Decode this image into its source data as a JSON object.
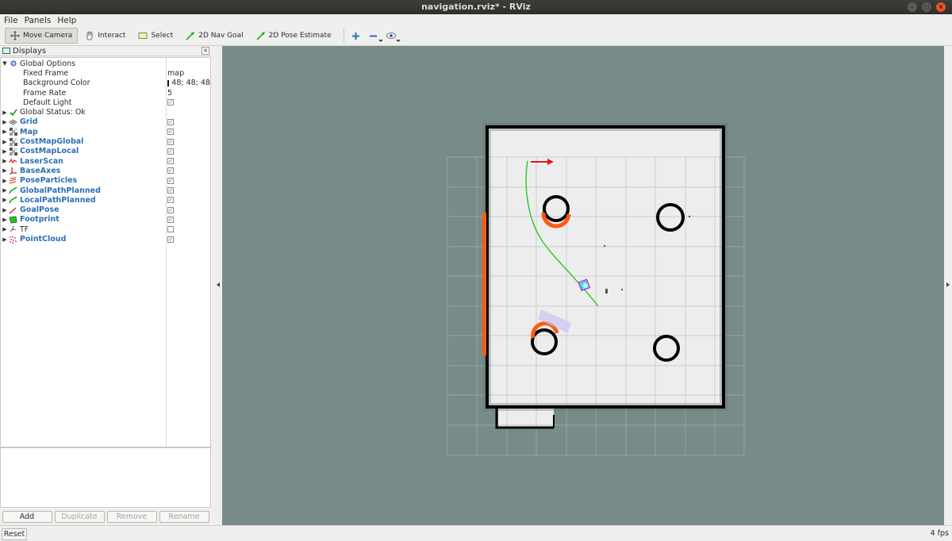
{
  "window": {
    "title": "navigation.rviz* - RViz"
  },
  "menu": [
    "File",
    "Panels",
    "Help"
  ],
  "toolbar": {
    "tools": [
      {
        "label": "Move Camera",
        "icon": "move-camera-icon",
        "active": true
      },
      {
        "label": "Interact",
        "icon": "hand-icon",
        "active": false
      },
      {
        "label": "Select",
        "icon": "select-box-icon",
        "active": false
      },
      {
        "label": "2D Nav Goal",
        "icon": "green-arrow-icon",
        "active": false
      },
      {
        "label": "2D Pose Estimate",
        "icon": "green-arrow-icon",
        "active": false
      }
    ],
    "icon_buttons": [
      "add-tool-icon",
      "remove-tool-icon",
      "camera-view-icon"
    ]
  },
  "displays_panel": {
    "title": "Displays",
    "items": [
      {
        "label": "Global Options",
        "expanded": true,
        "icon": "gear-icon",
        "blue": false,
        "value": ""
      },
      {
        "label": "Fixed Frame",
        "child": true,
        "value": "map"
      },
      {
        "label": "Background Color",
        "child": true,
        "value": "48; 48; 48",
        "swatch": "#303030"
      },
      {
        "label": "Frame Rate",
        "child": true,
        "value": "5"
      },
      {
        "label": "Default Light",
        "child": true,
        "checked": true
      },
      {
        "label": "Global Status: Ok",
        "icon": "check-icon",
        "blue": false
      },
      {
        "label": "Grid",
        "icon": "grid-icon",
        "blue": true,
        "checked": true
      },
      {
        "label": "Map",
        "icon": "map-icon",
        "blue": true,
        "checked": true
      },
      {
        "label": "CostMapGlobal",
        "icon": "map-icon",
        "blue": true,
        "checked": true
      },
      {
        "label": "CostMapLocal",
        "icon": "map-icon",
        "blue": true,
        "checked": true
      },
      {
        "label": "LaserScan",
        "icon": "laser-icon",
        "blue": true,
        "checked": true
      },
      {
        "label": "BaseAxes",
        "icon": "axes-icon",
        "blue": true,
        "checked": true
      },
      {
        "label": "PoseParticles",
        "icon": "pose-array-icon",
        "blue": true,
        "checked": true
      },
      {
        "label": "GlobalPathPlanned",
        "icon": "path-icon",
        "blue": true,
        "checked": true
      },
      {
        "label": "LocalPathPlanned",
        "icon": "path-icon",
        "blue": true,
        "checked": true
      },
      {
        "label": "GoalPose",
        "icon": "pose-icon",
        "blue": true,
        "checked": true
      },
      {
        "label": "Footprint",
        "icon": "polygon-icon",
        "blue": true,
        "checked": true
      },
      {
        "label": "TF",
        "icon": "tf-icon",
        "blue": false,
        "checked": false
      },
      {
        "label": "PointCloud",
        "icon": "pointcloud-icon",
        "blue": true,
        "checked": true
      }
    ],
    "buttons": {
      "add": "Add",
      "duplicate": "Duplicate",
      "remove": "Remove",
      "rename": "Rename"
    }
  },
  "status": {
    "reset": "Reset",
    "fps": "4 fps"
  },
  "colors": {
    "viewport_bg": "#778b88",
    "map_free": "#efefef",
    "wall": "#000000",
    "inflation": "#ff5a12",
    "path": "#17c517",
    "goal_arrow": "#e01818"
  }
}
